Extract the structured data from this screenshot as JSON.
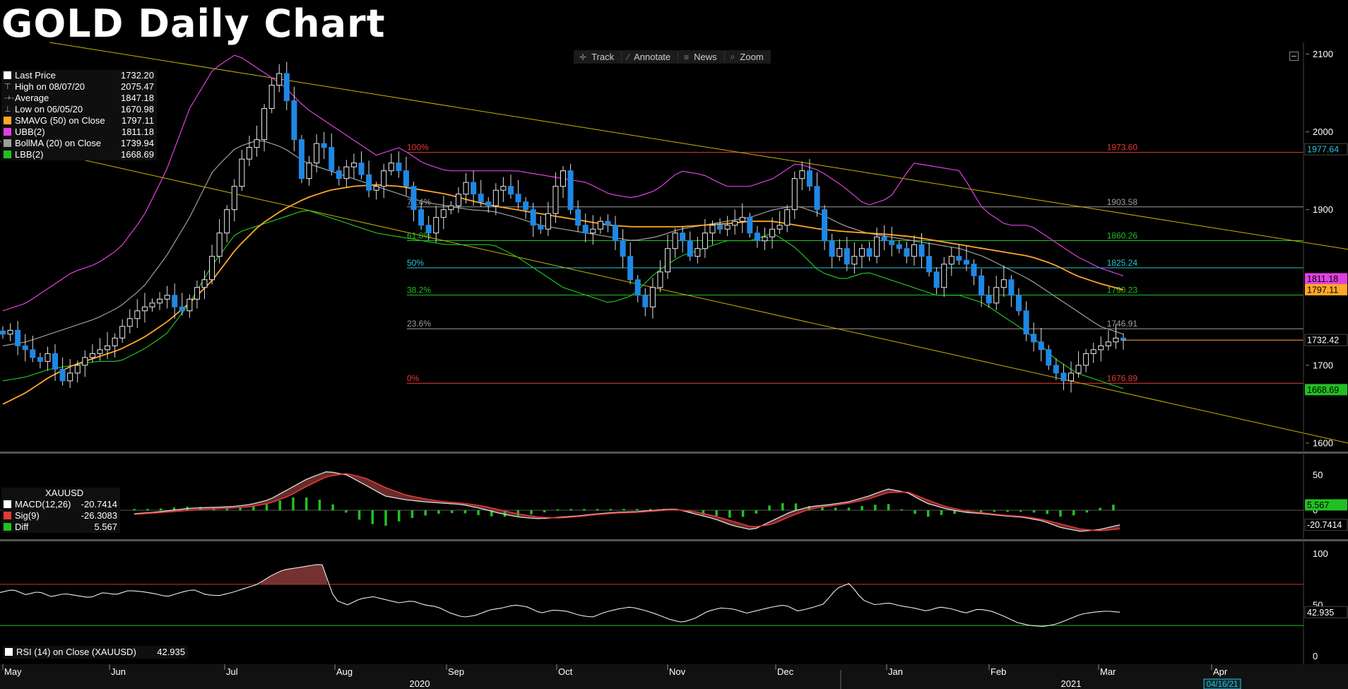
{
  "title": "GOLD Daily Chart",
  "toolbar": {
    "items": [
      {
        "label": "Track",
        "icon": "crosshair-icon"
      },
      {
        "label": "Annotate",
        "icon": "pen-icon"
      },
      {
        "label": "News",
        "icon": "news-icon"
      },
      {
        "label": "Zoom",
        "icon": "magnifier-icon"
      }
    ]
  },
  "price_legend": {
    "rows": [
      {
        "label": "Last Price",
        "value": "1732.20",
        "color": "#ffffff",
        "glyph": ""
      },
      {
        "label": "High on 08/07/20",
        "value": "2075.47",
        "color": "",
        "glyph": "⊤"
      },
      {
        "label": "Average",
        "value": "1847.18",
        "color": "",
        "glyph": "-+-"
      },
      {
        "label": "Low on 06/05/20",
        "value": "1670.98",
        "color": "",
        "glyph": "⊥"
      },
      {
        "label": "SMAVG (50)  on Close",
        "value": "1797.11",
        "color": "#ffa726",
        "glyph": ""
      },
      {
        "label": "UBB(2)",
        "value": "1811.18",
        "color": "#e040e0",
        "glyph": ""
      },
      {
        "label": "BollMA (20)  on Close",
        "value": "1739.94",
        "color": "#9e9e9e",
        "glyph": ""
      },
      {
        "label": "LBB(2)",
        "value": "1668.69",
        "color": "#21c021",
        "glyph": ""
      }
    ]
  },
  "macd_legend": {
    "ticker": "XAUUSD",
    "rows": [
      {
        "label": "MACD(12,26)",
        "value": "-20.7414",
        "color": "#ffffff"
      },
      {
        "label": "Sig(9)",
        "value": "-26.3083",
        "color": "#e53935"
      },
      {
        "label": "Diff",
        "value": "5.567",
        "color": "#21c021"
      }
    ]
  },
  "rsi_legend": {
    "label": "RSI (14)  on Close (XAUUSD)",
    "value": "42.935",
    "color": "#ffffff"
  },
  "chart_data": [
    {
      "type": "candlestick",
      "name": "price",
      "y_ticks": [
        1600,
        1700,
        1800,
        1900,
        2000,
        2100
      ],
      "ylim": [
        1590,
        2115
      ],
      "x_month_labels": [
        "May",
        "Jun",
        "Jul",
        "Aug",
        "Sep",
        "Oct",
        "Nov",
        "Dec",
        "Jan",
        "Feb",
        "Mar",
        "Apr"
      ],
      "x_year_labels": [
        "2020",
        "2021"
      ],
      "date_badge": "04/16/21",
      "close_path": [
        1740,
        1745,
        1725,
        1720,
        1710,
        1705,
        1715,
        1695,
        1680,
        1690,
        1700,
        1710,
        1715,
        1720,
        1725,
        1735,
        1750,
        1760,
        1770,
        1775,
        1780,
        1785,
        1790,
        1775,
        1770,
        1785,
        1800,
        1810,
        1840,
        1870,
        1900,
        1930,
        1965,
        1980,
        1990,
        2030,
        2060,
        2075,
        2040,
        1990,
        1940,
        1960,
        1985,
        1980,
        1950,
        1940,
        1955,
        1960,
        1945,
        1925,
        1930,
        1950,
        1960,
        1950,
        1930,
        1900,
        1880,
        1870,
        1890,
        1900,
        1905,
        1920,
        1935,
        1920,
        1910,
        1905,
        1925,
        1930,
        1920,
        1910,
        1900,
        1880,
        1875,
        1895,
        1930,
        1950,
        1900,
        1880,
        1870,
        1875,
        1885,
        1880,
        1860,
        1840,
        1810,
        1790,
        1775,
        1800,
        1820,
        1850,
        1870,
        1860,
        1840,
        1850,
        1870,
        1880,
        1875,
        1880,
        1885,
        1890,
        1870,
        1860,
        1865,
        1875,
        1880,
        1900,
        1940,
        1950,
        1930,
        1900,
        1860,
        1840,
        1850,
        1830,
        1840,
        1850,
        1840,
        1865,
        1860,
        1855,
        1850,
        1840,
        1855,
        1840,
        1820,
        1800,
        1830,
        1840,
        1835,
        1830,
        1815,
        1790,
        1780,
        1800,
        1810,
        1790,
        1770,
        1740,
        1730,
        1720,
        1700,
        1690,
        1680,
        1690,
        1700,
        1715,
        1720,
        1725,
        1730,
        1735,
        1732
      ],
      "moving_averages": [
        {
          "name": "UBB(2)",
          "color": "#e040e0",
          "values": [
            1770,
            1780,
            1800,
            1820,
            1830,
            1850,
            1890,
            1950,
            2030,
            2080,
            2100,
            2080,
            2060,
            2030,
            2010,
            1990,
            1970,
            1980,
            1960,
            1950,
            1950,
            1950,
            1950,
            1945,
            1940,
            1935,
            1920,
            1915,
            1925,
            1950,
            1945,
            1930,
            1930,
            1940,
            1960,
            1950,
            1930,
            1905,
            1915,
            1960,
            1955,
            1950,
            1900,
            1880,
            1880,
            1860,
            1840,
            1825,
            1815
          ]
        },
        {
          "name": "BollMA (20)",
          "color": "#9e9e9e",
          "values": [
            1725,
            1730,
            1740,
            1750,
            1760,
            1775,
            1800,
            1840,
            1890,
            1950,
            1980,
            1990,
            1980,
            1960,
            1950,
            1940,
            1930,
            1920,
            1910,
            1905,
            1900,
            1898,
            1890,
            1880,
            1875,
            1870,
            1865,
            1860,
            1865,
            1875,
            1880,
            1885,
            1890,
            1900,
            1905,
            1895,
            1880,
            1870,
            1865,
            1860,
            1855,
            1850,
            1840,
            1825,
            1810,
            1790,
            1770,
            1750,
            1740
          ]
        },
        {
          "name": "LBB(2)",
          "color": "#21c021",
          "values": [
            1680,
            1685,
            1695,
            1700,
            1705,
            1705,
            1720,
            1740,
            1780,
            1830,
            1870,
            1880,
            1890,
            1900,
            1890,
            1880,
            1870,
            1865,
            1860,
            1855,
            1855,
            1855,
            1840,
            1820,
            1800,
            1790,
            1780,
            1790,
            1820,
            1840,
            1850,
            1860,
            1860,
            1870,
            1850,
            1820,
            1810,
            1820,
            1810,
            1800,
            1790,
            1790,
            1780,
            1760,
            1740,
            1710,
            1690,
            1680,
            1670
          ]
        },
        {
          "name": "SMAVG (50)",
          "color": "#ffa726",
          "values": [
            1650,
            1665,
            1685,
            1700,
            1710,
            1720,
            1735,
            1755,
            1780,
            1810,
            1850,
            1880,
            1900,
            1915,
            1925,
            1930,
            1932,
            1930,
            1925,
            1920,
            1912,
            1905,
            1900,
            1895,
            1890,
            1885,
            1880,
            1878,
            1878,
            1878,
            1880,
            1882,
            1885,
            1885,
            1880,
            1875,
            1872,
            1870,
            1868,
            1865,
            1860,
            1855,
            1850,
            1845,
            1840,
            1830,
            1815,
            1805,
            1797
          ]
        }
      ],
      "fibonacci": [
        {
          "label": "100%",
          "value": 1973.6,
          "color": "#e53935"
        },
        {
          "label": "76.4%",
          "value": 1903.58,
          "color": "#9e9e9e"
        },
        {
          "label": "61.8%",
          "value": 1860.26,
          "color": "#21c021"
        },
        {
          "label": "50%",
          "value": 1825.24,
          "color": "#26c6da"
        },
        {
          "label": "38.2%",
          "value": 1790.23,
          "color": "#21c021"
        },
        {
          "label": "23.6%",
          "value": 1746.91,
          "color": "#9e9e9e"
        },
        {
          "label": "0%",
          "value": 1676.89,
          "color": "#e53935"
        }
      ],
      "fibonacci_value_labels": [
        "1973.60",
        "1903.58",
        "1860.26",
        "1825.24",
        "1790.23",
        "1746.91",
        "1676.89"
      ],
      "axis_badges": [
        {
          "label": "1977.64",
          "value": 1977.64,
          "bg": "#000000",
          "fg": "#26c6da"
        },
        {
          "label": "1811.18",
          "value": 1811.18,
          "bg": "#e040e0",
          "fg": "#000000"
        },
        {
          "label": "1797.11",
          "value": 1797.11,
          "bg": "#ffa726",
          "fg": "#000000"
        },
        {
          "label": "1732.42",
          "value": 1732.42,
          "bg": "#000000",
          "fg": "#ffffff"
        },
        {
          "label": "1668.69",
          "value": 1668.69,
          "bg": "#21c021",
          "fg": "#000000"
        }
      ],
      "last_price_line": 1732.42,
      "trend_channel": {
        "color": "#c8b400",
        "upper": [
          2115,
          1849
        ],
        "lower": [
          1988,
          1600
        ]
      }
    },
    {
      "type": "macd",
      "name": "MACD",
      "y_ticks": [
        0,
        50
      ],
      "ylim": [
        -40,
        70
      ],
      "macd": [
        -5,
        -3,
        0,
        3,
        4,
        5,
        8,
        15,
        30,
        45,
        55,
        50,
        35,
        20,
        15,
        12,
        10,
        8,
        2,
        -5,
        -10,
        -12,
        -10,
        -8,
        -5,
        -3,
        -2,
        0,
        2,
        -5,
        -12,
        -22,
        -28,
        -15,
        -2,
        5,
        8,
        12,
        20,
        30,
        25,
        10,
        2,
        -3,
        -5,
        -8,
        -10,
        -15,
        -25,
        -30,
        -27,
        -20.74
      ],
      "signal": [
        -6,
        -4,
        -2,
        0,
        2,
        3,
        5,
        10,
        20,
        35,
        48,
        52,
        45,
        32,
        22,
        16,
        12,
        10,
        6,
        0,
        -6,
        -10,
        -11,
        -9,
        -6,
        -4,
        -3,
        -1,
        1,
        -2,
        -8,
        -16,
        -24,
        -20,
        -8,
        2,
        6,
        10,
        16,
        25,
        26,
        15,
        5,
        -1,
        -4,
        -7,
        -9,
        -13,
        -20,
        -27,
        -29,
        -26.31
      ],
      "badges": [
        {
          "label": "5.567",
          "value": 5.567,
          "bg": "#21c021",
          "fg": "#000000"
        },
        {
          "label": "-20.7414",
          "value": -20.7414,
          "bg": "#000000",
          "fg": "#ffffff"
        }
      ]
    },
    {
      "type": "line",
      "name": "RSI",
      "y_ticks": [
        0,
        50,
        100
      ],
      "ylim": [
        -5,
        105
      ],
      "overbought": 70,
      "oversold": 30,
      "values": [
        62,
        65,
        60,
        63,
        58,
        61,
        59,
        57,
        62,
        60,
        64,
        63,
        61,
        58,
        62,
        65,
        60,
        59,
        62,
        66,
        70,
        78,
        84,
        86,
        88,
        90,
        55,
        50,
        56,
        58,
        55,
        52,
        54,
        50,
        48,
        42,
        38,
        40,
        45,
        47,
        50,
        48,
        42,
        45,
        44,
        40,
        38,
        43,
        46,
        48,
        45,
        41,
        36,
        33,
        37,
        44,
        47,
        46,
        42,
        45,
        48,
        50,
        44,
        47,
        51,
        66,
        71,
        55,
        50,
        52,
        49,
        47,
        44,
        48,
        46,
        42,
        46,
        44,
        39,
        33,
        30,
        29,
        31,
        36,
        41,
        43,
        44,
        42.935
      ],
      "badge": {
        "label": "42.935",
        "value": 42.935,
        "bg": "#000000",
        "fg": "#ffffff"
      }
    }
  ]
}
